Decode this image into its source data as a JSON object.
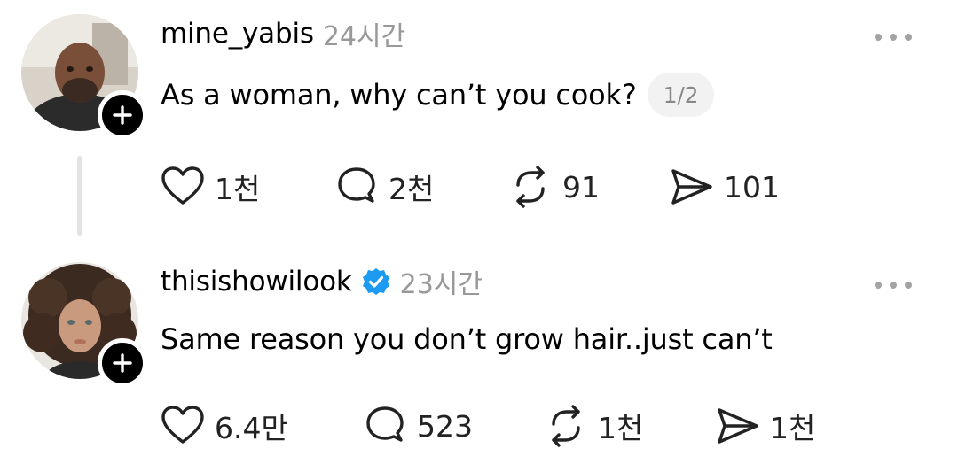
{
  "posts": [
    {
      "username": "mine_yabis",
      "timestamp": "24시간",
      "text": "As a woman, why can’t you cook?",
      "page_indicator": "1/2",
      "verified": false,
      "counts": {
        "like": "1천",
        "reply": "2천",
        "repost": "91",
        "share": "101"
      }
    },
    {
      "username": "thisishowilook",
      "timestamp": "23시간",
      "text": "Same reason you don’t grow hair..just can’t",
      "verified": true,
      "counts": {
        "like": "6.4만",
        "reply": "523",
        "repost": "1천",
        "share": "1천"
      }
    }
  ],
  "icons": {
    "like": "heart-icon",
    "reply": "comment-icon",
    "repost": "repost-icon",
    "share": "send-icon",
    "more": "more-options-icon",
    "follow": "plus-icon",
    "verified": "verified-badge-icon"
  },
  "colors": {
    "verified": "#1d9bf0",
    "muted": "#999999",
    "pill_bg": "#f2f2f2"
  }
}
